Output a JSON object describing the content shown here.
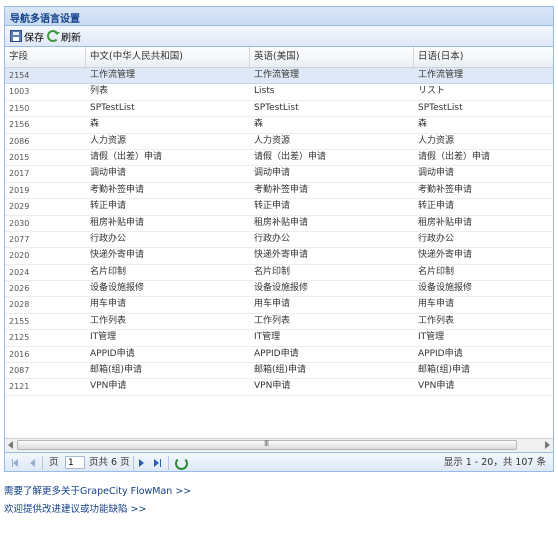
{
  "panel": {
    "title": "导航多语言设置"
  },
  "toolbar": {
    "save_label": "保存",
    "refresh_label": "刷新"
  },
  "columns": [
    "字段",
    "中文(中华人民共和国)",
    "英语(美国)",
    "日语(日本)"
  ],
  "rows": [
    [
      "2154",
      "工作流管理",
      "工作流管理",
      "工作流管理"
    ],
    [
      "1003",
      "列表",
      "Lists",
      "リスト"
    ],
    [
      "2150",
      "SPTestList",
      "SPTestList",
      "SPTestList"
    ],
    [
      "2156",
      "森",
      "森",
      "森"
    ],
    [
      "2086",
      "人力资源",
      "人力资源",
      "人力资源"
    ],
    [
      "2015",
      "请假（出差）申请",
      "请假（出差）申请",
      "请假（出差）申请"
    ],
    [
      "2017",
      "调动申请",
      "调动申请",
      "调动申请"
    ],
    [
      "2019",
      "考勤补签申请",
      "考勤补签申请",
      "考勤补签申请"
    ],
    [
      "2029",
      "转正申请",
      "转正申请",
      "转正申请"
    ],
    [
      "2030",
      "租房补贴申请",
      "租房补贴申请",
      "租房补贴申请"
    ],
    [
      "2077",
      "行政办公",
      "行政办公",
      "行政办公"
    ],
    [
      "2020",
      "快递外寄申请",
      "快递外寄申请",
      "快递外寄申请"
    ],
    [
      "2024",
      "名片印制",
      "名片印制",
      "名片印制"
    ],
    [
      "2026",
      "设备设施报修",
      "设备设施报修",
      "设备设施报修"
    ],
    [
      "2028",
      "用车申请",
      "用车申请",
      "用车申请"
    ],
    [
      "2155",
      "工作列表",
      "工作列表",
      "工作列表"
    ],
    [
      "2125",
      "IT管理",
      "IT管理",
      "IT管理"
    ],
    [
      "2016",
      "APPID申请",
      "APPID申请",
      "APPID申请"
    ],
    [
      "2087",
      "邮箱(组)申请",
      "邮箱(组)申请",
      "邮箱(组)申请"
    ],
    [
      "2121",
      "VPN申请",
      "VPN申请",
      "VPN申请"
    ]
  ],
  "scrollbar": {
    "thumb_grip": "III"
  },
  "pager": {
    "page_label": "页",
    "page_value": "1",
    "total_label": "页共 6 页",
    "status": "显示 1 - 20，共 107 条"
  },
  "footer": {
    "link1": "需要了解更多关于GrapeCity FlowMan >>",
    "link2": "欢迎提供改进建议或功能缺陷 >>"
  },
  "colors": {
    "header_text": "#15428b",
    "border": "#99bbe8",
    "selected_row": "#dfe8f6"
  },
  "icons": [
    "save-icon",
    "refresh-icon",
    "first-page-icon",
    "prev-page-icon",
    "next-page-icon",
    "last-page-icon",
    "reload-icon"
  ]
}
